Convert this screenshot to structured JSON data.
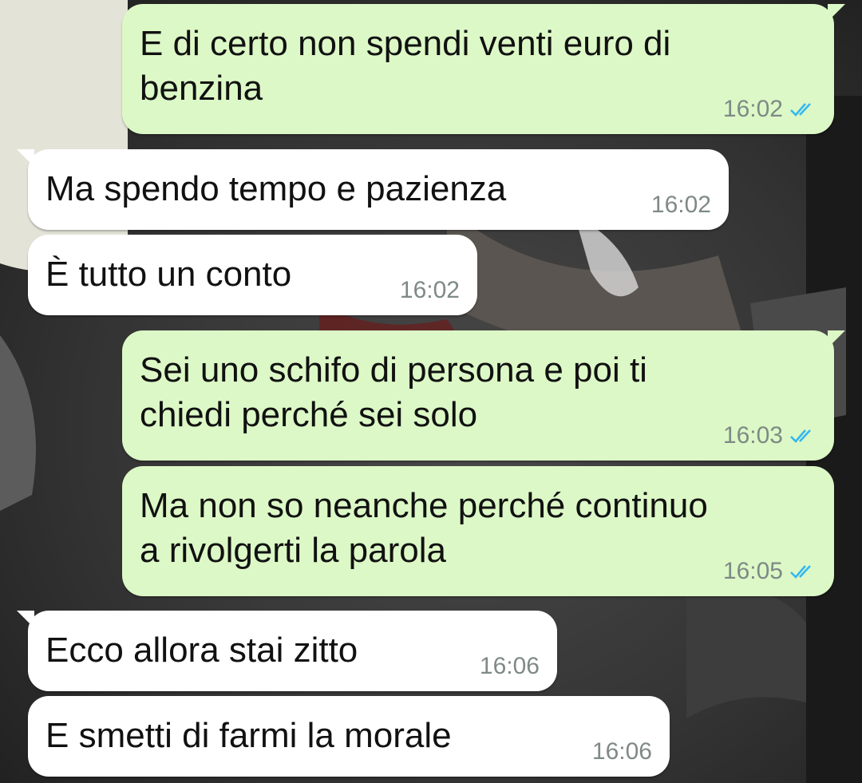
{
  "colors": {
    "outgoing_bubble": "#dcf8c6",
    "incoming_bubble": "#ffffff",
    "read_ticks": "#34b7f1",
    "timestamp": "#7e8a86"
  },
  "messages": [
    {
      "direction": "outgoing",
      "text": "E di certo non spendi venti euro di benzina",
      "time": "16:02",
      "status": "read",
      "tail": true
    },
    {
      "direction": "incoming",
      "text": "Ma spendo tempo e pazienza",
      "time": "16:02",
      "tail": true
    },
    {
      "direction": "incoming",
      "text": "È tutto un conto",
      "time": "16:02",
      "tail": false
    },
    {
      "direction": "outgoing",
      "text": "Sei uno schifo di persona e poi ti chiedi perché sei solo",
      "time": "16:03",
      "status": "read",
      "tail": true
    },
    {
      "direction": "outgoing",
      "text": "Ma non so neanche perché continuo a rivolgerti la parola",
      "time": "16:05",
      "status": "read",
      "tail": false
    },
    {
      "direction": "incoming",
      "text": "Ecco allora stai zitto",
      "time": "16:06",
      "tail": true
    },
    {
      "direction": "incoming",
      "text": "E smetti di farmi la morale",
      "time": "16:06",
      "tail": false
    }
  ]
}
